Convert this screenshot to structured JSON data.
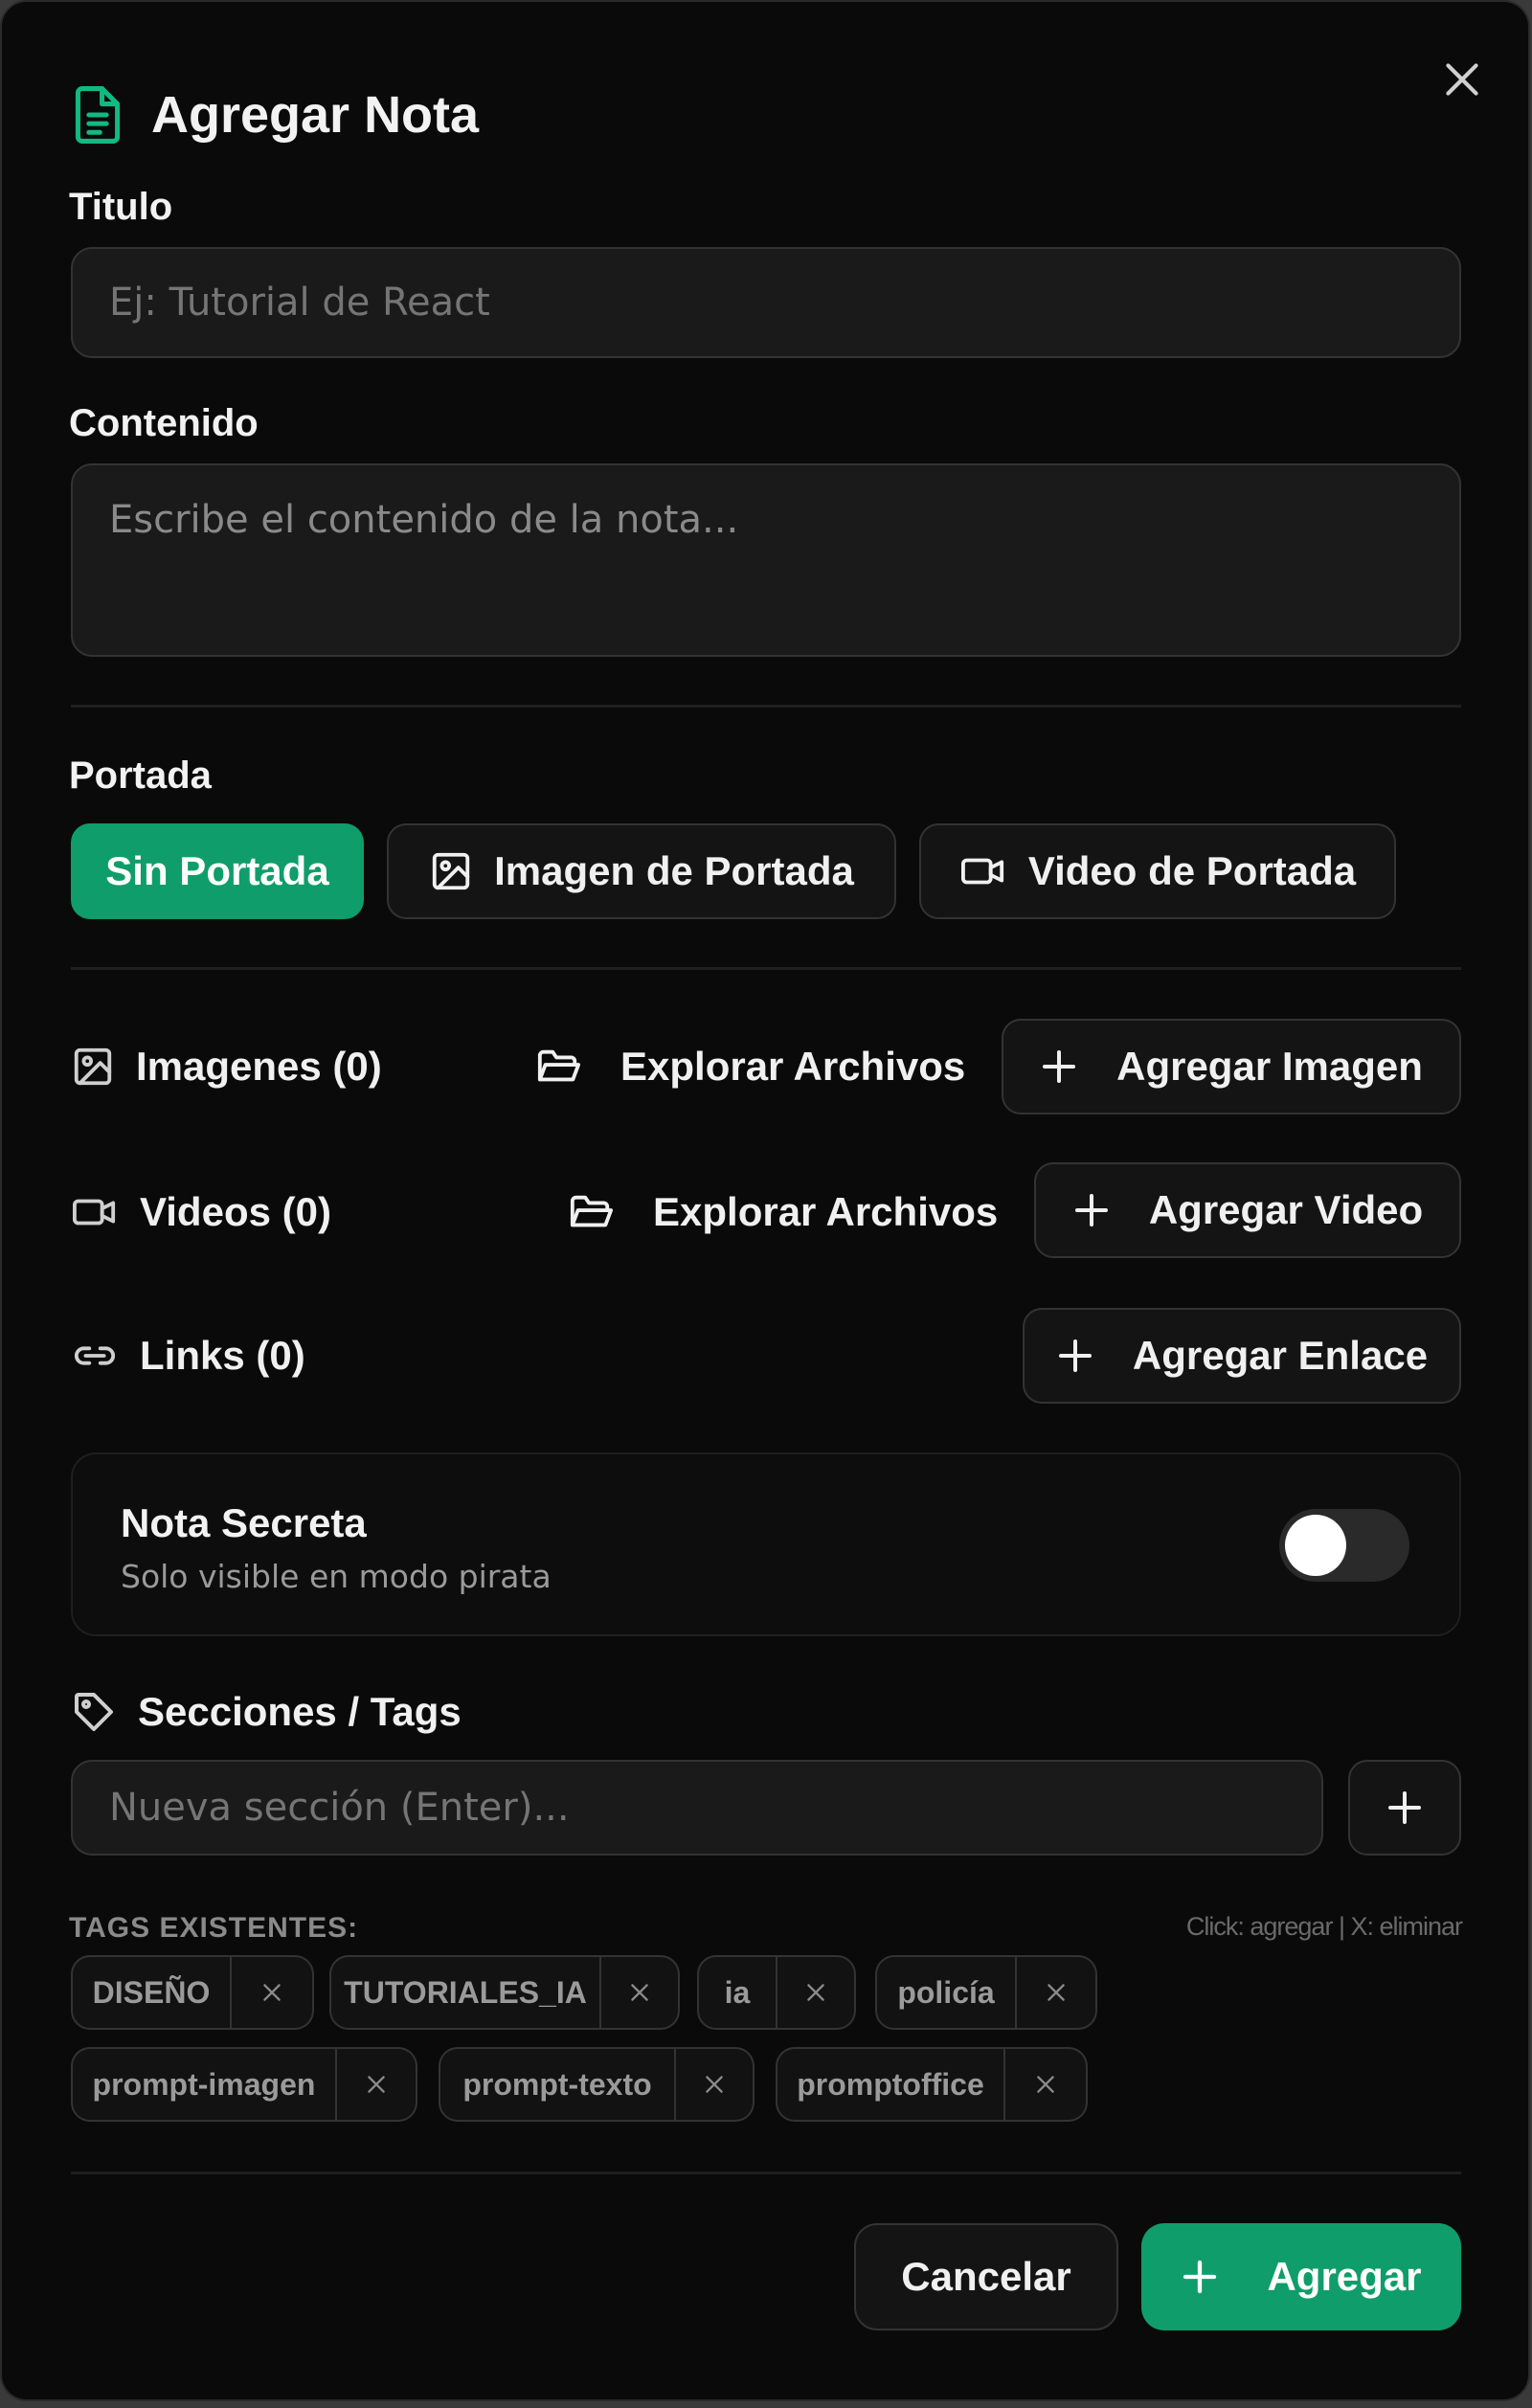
{
  "header": {
    "title": "Agregar Nota",
    "doc_icon": "doc-icon",
    "close_icon": "close-icon"
  },
  "titulo": {
    "label": "Titulo",
    "placeholder": "Ej: Tutorial de React",
    "value": ""
  },
  "contenido": {
    "label": "Contenido",
    "placeholder": "Escribe el contenido de la nota...",
    "value": ""
  },
  "portada": {
    "label": "Portada",
    "options": [
      "Sin Portada",
      "Imagen de Portada",
      "Video de Portada"
    ],
    "selected": "Sin Portada"
  },
  "media": {
    "imagenes": {
      "label": "Imagenes (0)",
      "explore": "Explorar Archivos",
      "add": "Agregar Imagen"
    },
    "videos": {
      "label": "Videos (0)",
      "explore": "Explorar Archivos",
      "add": "Agregar Video"
    },
    "links": {
      "label": "Links (0)",
      "add": "Agregar Enlace"
    }
  },
  "secret": {
    "title": "Nota Secreta",
    "subtitle": "Solo visible en modo pirata",
    "enabled": false
  },
  "tags": {
    "label": "Secciones / Tags",
    "input_placeholder": "Nueva sección (Enter)...",
    "existing_label": "TAGS EXISTENTES:",
    "hint": "Click: agregar | X: eliminar",
    "items": [
      "DISEÑO",
      "TUTORIALES_IA",
      "ia",
      "policía",
      "prompt-imagen",
      "prompt-texto",
      "promptoffice"
    ]
  },
  "footer": {
    "cancel": "Cancelar",
    "submit": "Agregar"
  },
  "colors": {
    "accent": "#0f9d6b",
    "background": "#0a0a0a",
    "surface": "#1a1a1a",
    "border": "#333333"
  }
}
